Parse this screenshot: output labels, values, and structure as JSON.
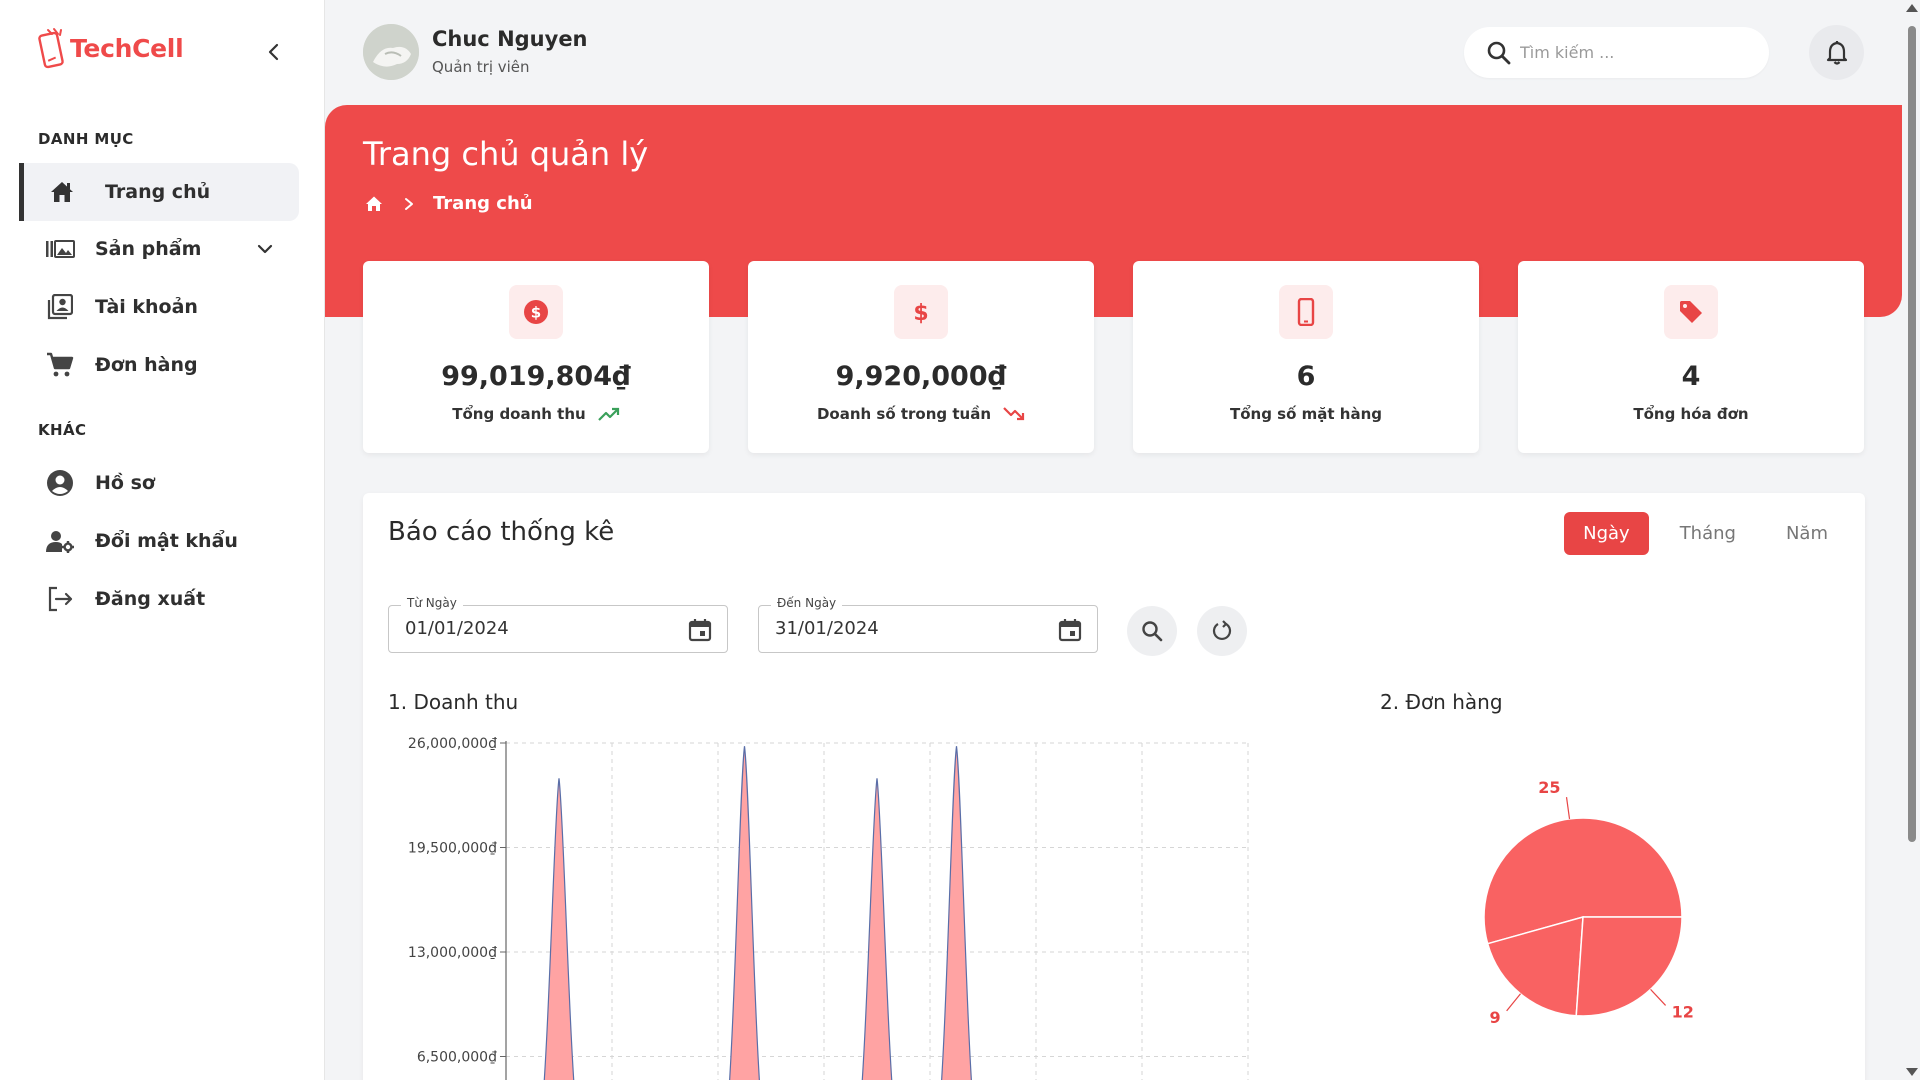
{
  "brand": {
    "name": "TechCell",
    "accent": "#ee4a4a"
  },
  "sidebar": {
    "section_main": "DANH MỤC",
    "section_other": "KHÁC",
    "items": [
      {
        "label": "Trang chủ",
        "icon": "home-icon",
        "active": true
      },
      {
        "label": "Sản phẩm",
        "icon": "products-icon",
        "has_submenu": true
      },
      {
        "label": "Tài khoản",
        "icon": "accounts-icon"
      },
      {
        "label": "Đơn hàng",
        "icon": "cart-icon"
      }
    ],
    "other_items": [
      {
        "label": "Hồ sơ",
        "icon": "profile-icon"
      },
      {
        "label": "Đổi mật khẩu",
        "icon": "user-key-icon"
      },
      {
        "label": "Đăng xuất",
        "icon": "logout-icon"
      }
    ]
  },
  "header": {
    "user_name": "Chuc Nguyen",
    "user_role": "Quản trị viên",
    "search_placeholder": "Tìm kiếm ..."
  },
  "page": {
    "title": "Trang chủ quản lý",
    "breadcrumb_current": "Trang chủ"
  },
  "stats": [
    {
      "value": "99,019,804₫",
      "label": "Tổng doanh thu",
      "icon": "dollar-circle-icon",
      "trend": "up"
    },
    {
      "value": "9,920,000₫",
      "label": "Doanh số trong tuần",
      "icon": "dollar-icon",
      "trend": "down"
    },
    {
      "value": "6",
      "label": "Tổng số mặt hàng",
      "icon": "phone-icon"
    },
    {
      "value": "4",
      "label": "Tổng hóa đơn",
      "icon": "tag-icon"
    }
  ],
  "report": {
    "title": "Báo cáo thống kê",
    "tabs": [
      "Ngày",
      "Tháng",
      "Năm"
    ],
    "active_tab": "Ngày",
    "from_label": "Từ Ngày",
    "from_value": "01/01/2024",
    "to_label": "Đến Ngày",
    "to_value": "31/01/2024",
    "revenue_title": "1. Doanh thu",
    "orders_title": "2. Đơn hàng"
  },
  "chart_data": [
    {
      "type": "area",
      "title": "1. Doanh thu",
      "y_ticks": [
        "26,000,000₫",
        "19,500,000₫",
        "13,000,000₫",
        "6,500,000₫"
      ],
      "ylim": [
        0,
        26000000
      ],
      "grid": true,
      "peaks": [
        {
          "x": 0.5,
          "value": 23800000
        },
        {
          "x": 2.25,
          "value": 25800000
        },
        {
          "x": 3.5,
          "value": 23800000
        },
        {
          "x": 4.25,
          "value": 25800000
        }
      ],
      "x_columns": 7,
      "fill": "#ffa3a3",
      "stroke": "#5a6ea8"
    },
    {
      "type": "pie",
      "title": "2. Đơn hàng",
      "values": [
        25,
        9,
        12
      ],
      "labels": [
        "25",
        "9",
        "12"
      ],
      "fill": "#f96262",
      "label_color": "#e84545"
    }
  ]
}
